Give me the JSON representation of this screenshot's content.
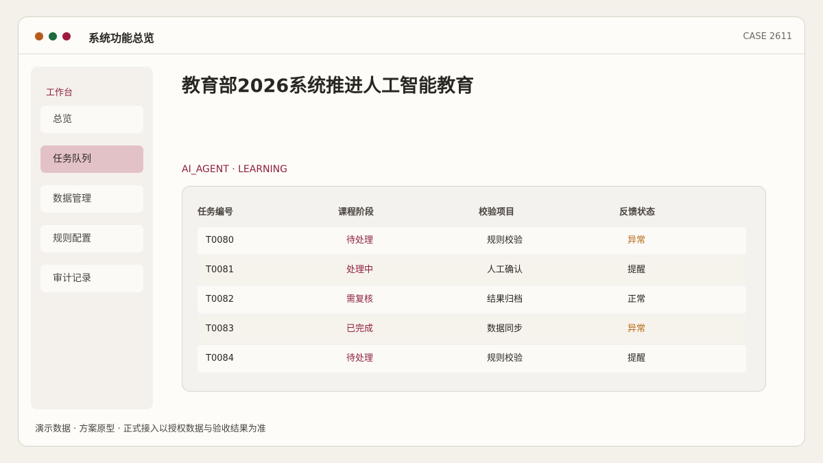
{
  "window": {
    "title": "系统功能总览",
    "case_id": "CASE 2611"
  },
  "sidebar": {
    "section_label": "工作台",
    "items": [
      {
        "label": "总览",
        "active": false
      },
      {
        "label": "任务队列",
        "active": true
      },
      {
        "label": "数据管理",
        "active": false
      },
      {
        "label": "规则配置",
        "active": false
      },
      {
        "label": "审计记录",
        "active": false
      }
    ]
  },
  "main": {
    "title": "教育部2026系统推进人工智能教育",
    "tagline": "AI_AGENT · LEARNING",
    "table": {
      "headers": [
        "任务编号",
        "课程阶段",
        "校验项目",
        "反馈状态"
      ],
      "rows": [
        {
          "id": "T0080",
          "stage": "待处理",
          "check": "规则校验",
          "status": "异常"
        },
        {
          "id": "T0081",
          "stage": "处理中",
          "check": "人工确认",
          "status": "提醒"
        },
        {
          "id": "T0082",
          "stage": "需复核",
          "check": "结果归档",
          "status": "正常"
        },
        {
          "id": "T0083",
          "stage": "已完成",
          "check": "数据同步",
          "status": "异常"
        },
        {
          "id": "T0084",
          "stage": "待处理",
          "check": "规则校验",
          "status": "提醒"
        }
      ]
    }
  },
  "footer": {
    "note": "演示数据 · 方案原型 · 正式接入以授权数据与验收结果为准"
  },
  "colors": {
    "accent": "#8e1f3c",
    "warning": "#b86a18",
    "active_nav": "#e3c2c7",
    "dot_orange": "#b85a1e",
    "dot_green": "#1f6a3e",
    "dot_red": "#9e1a3e"
  }
}
